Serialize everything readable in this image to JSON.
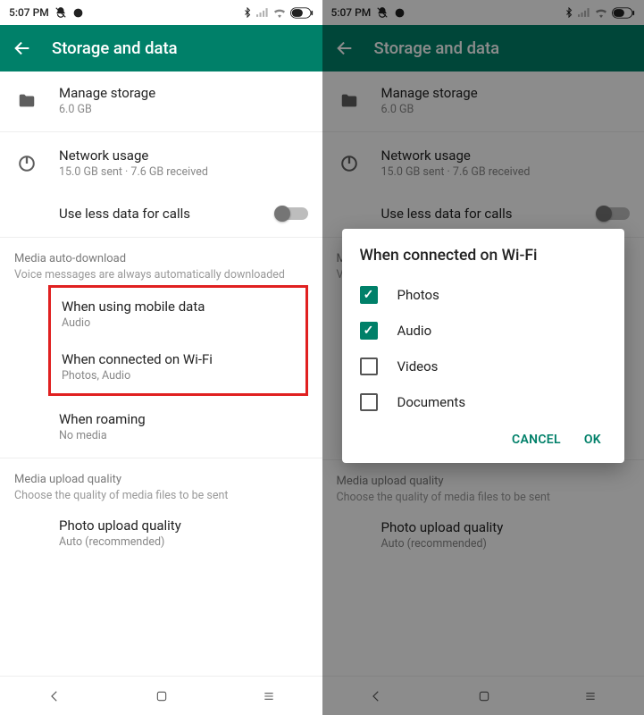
{
  "status": {
    "time": "5:07 PM"
  },
  "header": {
    "title": "Storage and data"
  },
  "storage": {
    "title": "Manage storage",
    "subtitle": "6.0 GB"
  },
  "network": {
    "title": "Network usage",
    "subtitle": "15.0 GB sent · 7.6 GB received"
  },
  "lessdata": {
    "title": "Use less data for calls"
  },
  "autodl": {
    "section": "Media auto-download",
    "hint": "Voice messages are always automatically downloaded",
    "mobile": {
      "title": "When using mobile data",
      "subtitle": "Audio"
    },
    "wifi": {
      "title": "When connected on Wi-Fi",
      "subtitle": "Photos, Audio"
    },
    "roaming": {
      "title": "When roaming",
      "subtitle": "No media"
    }
  },
  "upload": {
    "section": "Media upload quality",
    "hint": "Choose the quality of media files to be sent",
    "photo": {
      "title": "Photo upload quality",
      "subtitle": "Auto (recommended)"
    }
  },
  "dialog": {
    "title": "When connected on Wi-Fi",
    "options": {
      "photos": "Photos",
      "audio": "Audio",
      "videos": "Videos",
      "documents": "Documents"
    },
    "cancel": "CANCEL",
    "ok": "OK"
  }
}
